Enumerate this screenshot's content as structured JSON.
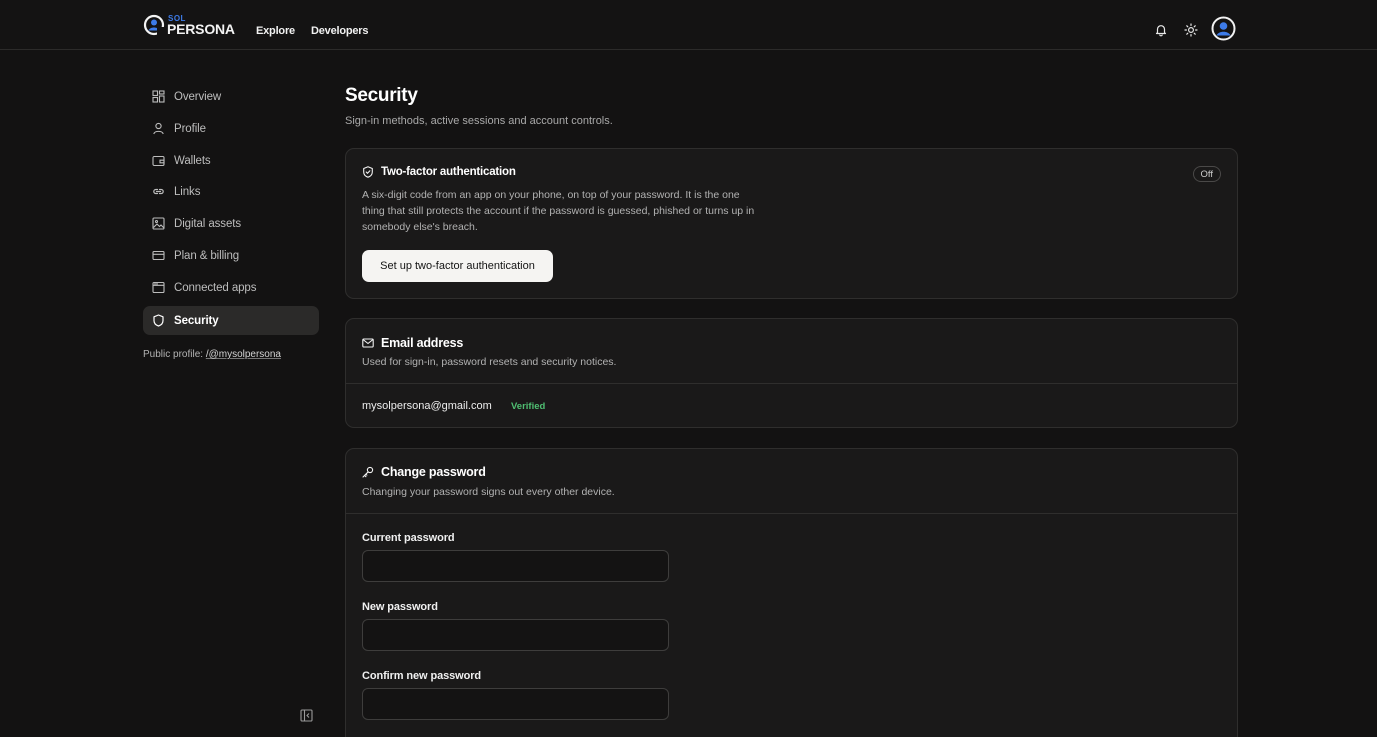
{
  "brand": {
    "small": "SOL",
    "big": "PERSONA",
    "accent": "#3d7be8"
  },
  "topnav": {
    "explore": "Explore",
    "developers": "Developers"
  },
  "top_icons": [
    "bell-icon",
    "sun-icon",
    "avatar"
  ],
  "sidebar": {
    "items": [
      {
        "label": "Overview",
        "icon": "grid-icon"
      },
      {
        "label": "Profile",
        "icon": "user-icon"
      },
      {
        "label": "Wallets",
        "icon": "wallet-icon"
      },
      {
        "label": "Links",
        "icon": "link-icon"
      },
      {
        "label": "Digital assets",
        "icon": "image-icon"
      },
      {
        "label": "Plan & billing",
        "icon": "credit-card-icon"
      },
      {
        "label": "Connected apps",
        "icon": "app-window-icon"
      },
      {
        "label": "Security",
        "icon": "shield-icon",
        "active": true
      }
    ],
    "public_profile_label": "Public profile:",
    "public_profile_handle": "/@mysolpersona"
  },
  "page": {
    "title": "Security",
    "subtitle": "Sign-in methods, active sessions and account controls."
  },
  "two_factor": {
    "title": "Two-factor authentication",
    "status": "Off",
    "description": "A six-digit code from an app on your phone, on top of your password. It is the one thing that still protects the account if the password is guessed, phished or turns up in somebody else's breach.",
    "button": "Set up two-factor authentication"
  },
  "email": {
    "title": "Email address",
    "description": "Used for sign-in, password resets and security notices.",
    "value": "mysolpersona@gmail.com",
    "badge": "Verified",
    "badge_color": "#4fbf72"
  },
  "change_password": {
    "title": "Change password",
    "description": "Changing your password signs out every other device.",
    "current_label": "Current password",
    "current_value": "",
    "new_label": "New password",
    "new_value": "",
    "confirm_label": "Confirm new password",
    "confirm_value": ""
  }
}
